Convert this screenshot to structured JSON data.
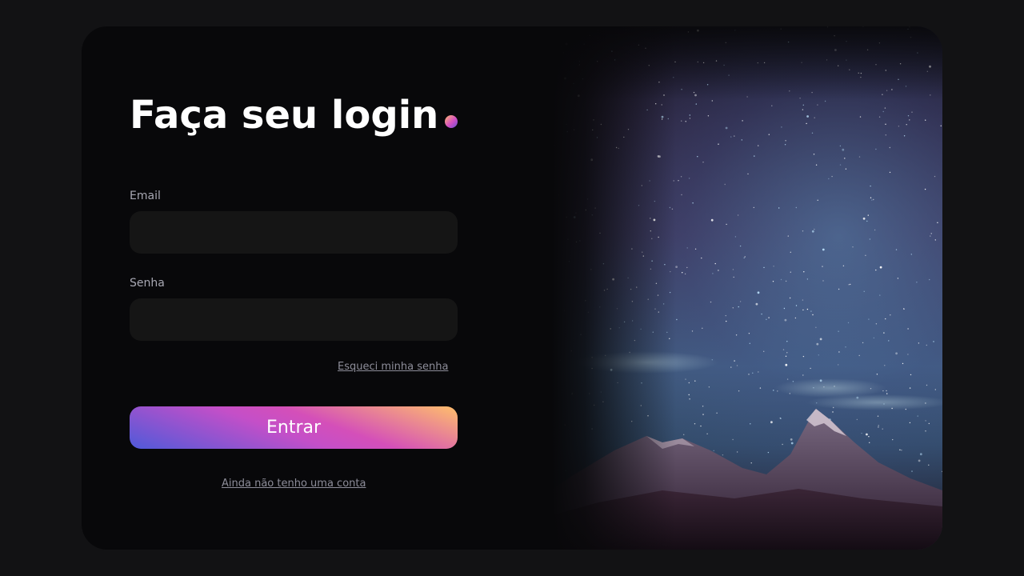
{
  "login": {
    "title": "Faça seu login",
    "email_label": "Email",
    "email_value": "",
    "password_label": "Senha",
    "password_value": "",
    "forgot_link": "Esqueci minha senha",
    "submit_label": "Entrar",
    "signup_link": "Ainda não tenho uma conta"
  },
  "colors": {
    "background": "#121214",
    "card": "#08080a",
    "input": "#151515",
    "label": "#a8a8b3",
    "gradient": [
      "#4f5ad9",
      "#c44fc8",
      "#ffbf6b"
    ]
  },
  "icons": {
    "title_dot": "gradient-dot"
  },
  "hero": {
    "image": "starry-sky-mountains"
  }
}
